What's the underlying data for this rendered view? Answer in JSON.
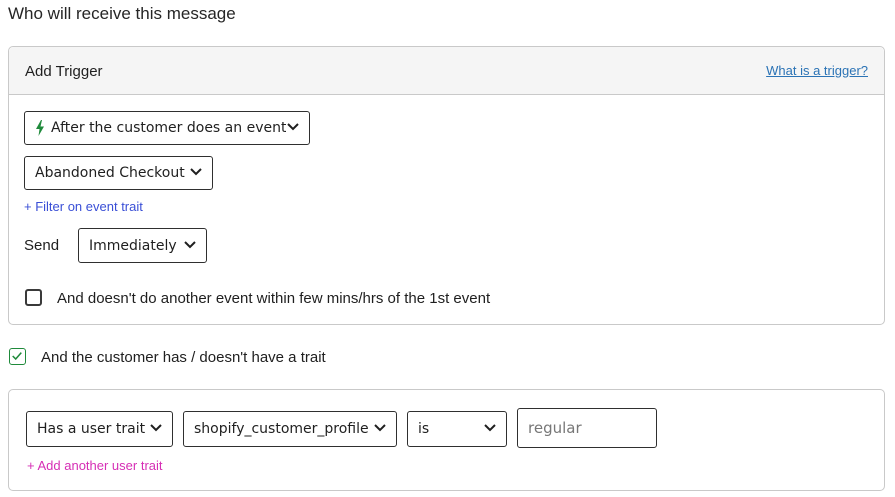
{
  "section": {
    "title": "Who will receive this message"
  },
  "trigger_card": {
    "title": "Add Trigger",
    "help_link": "What is a trigger?",
    "event_type_select": {
      "value": "After the customer does an event",
      "icon": "bolt-icon"
    },
    "event_select": {
      "value": "Abandoned Checkout"
    },
    "filter_link": "+ Filter on event trait",
    "send_label": "Send",
    "send_select": {
      "value": "Immediately"
    },
    "exclusion_checkbox": {
      "label": "And doesn't do another event within few mins/hrs of the 1st event",
      "checked": false
    }
  },
  "trait_toggle": {
    "label": "And the customer has / doesn't have a trait",
    "checked": true
  },
  "trait_card": {
    "trait_mode_select": {
      "value": "Has a user trait"
    },
    "trait_name_select": {
      "value": "shopify_customer_profile"
    },
    "operator_select": {
      "value": "is"
    },
    "value_input": {
      "value": "",
      "placeholder": "regular"
    },
    "add_link": "+ Add another user trait"
  },
  "colors": {
    "accent_green": "#1f8a3b",
    "help_link": "#2b73b5",
    "filter_link": "#3a4fd6",
    "add_link": "#d62fb5",
    "header_bg": "#f5f5f5"
  }
}
